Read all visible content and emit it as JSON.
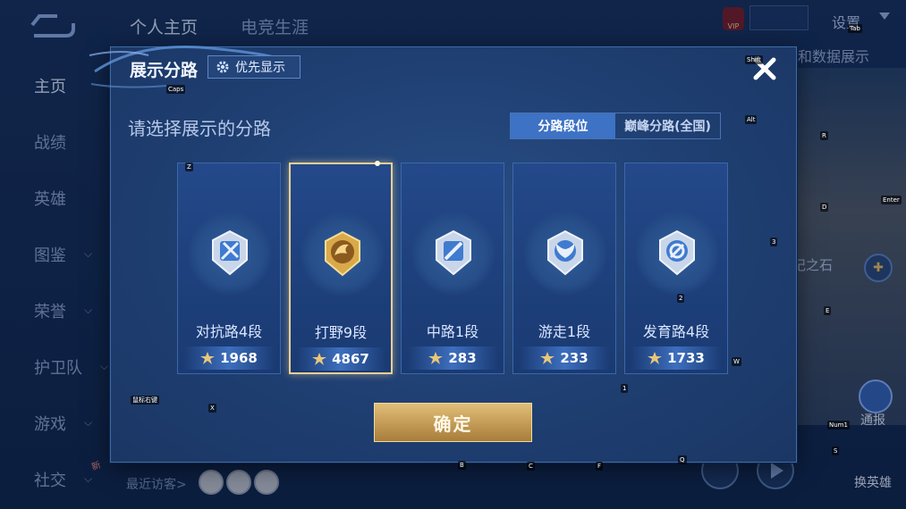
{
  "background": {
    "tabs": [
      "个人主页",
      "电竞生涯"
    ],
    "sidebar": [
      {
        "label": "主页",
        "active": true,
        "chevron": false
      },
      {
        "label": "战绩",
        "active": false,
        "chevron": false
      },
      {
        "label": "英雄",
        "active": false,
        "chevron": false
      },
      {
        "label": "图鉴",
        "active": false,
        "chevron": true
      },
      {
        "label": "荣誉",
        "active": false,
        "chevron": true
      },
      {
        "label": "护卫队",
        "active": false,
        "chevron": true
      },
      {
        "label": "游戏",
        "active": false,
        "chevron": true
      },
      {
        "label": "社交",
        "active": false,
        "chevron": true
      }
    ],
    "settings_label": "设置",
    "vip_label": "VIP",
    "right_label": "和数据展示",
    "stone_label": "记之石",
    "tongbao_label": "通报",
    "change_hero_label": "换英雄",
    "visitors_label": "最近访客>",
    "new_badge": "新"
  },
  "key_hints": [
    "Caps",
    "Shift",
    "Tab",
    "Alt",
    "Z",
    "R",
    "D",
    "Enter",
    "3",
    "2",
    "E",
    "W",
    "1",
    "X",
    "Num1",
    "S",
    "B",
    "C",
    "F",
    "Q",
    "鼠标右键"
  ],
  "modal": {
    "title": "展示分路",
    "priority_label": "优先显示",
    "prompt": "请选择展示的分路",
    "toggle": [
      "分路段位",
      "巅峰分路(全国)"
    ],
    "toggle_active": 0,
    "confirm_label": "确定",
    "lanes": [
      {
        "name": "对抗路4段",
        "score": "1968",
        "icon": "sword-shield-rank-icon",
        "selected": false
      },
      {
        "name": "打野9段",
        "score": "4867",
        "icon": "dragon-gold-rank-icon",
        "selected": true
      },
      {
        "name": "中路1段",
        "score": "283",
        "icon": "wand-rank-icon",
        "selected": false
      },
      {
        "name": "游走1段",
        "score": "233",
        "icon": "wings-rank-icon",
        "selected": false
      },
      {
        "name": "发育路4段",
        "score": "1733",
        "icon": "bow-rank-icon",
        "selected": false
      }
    ]
  },
  "colors": {
    "accent_blue": "#3d72c5",
    "gold": "#c39a55",
    "selected_border": "#e7cf96"
  }
}
